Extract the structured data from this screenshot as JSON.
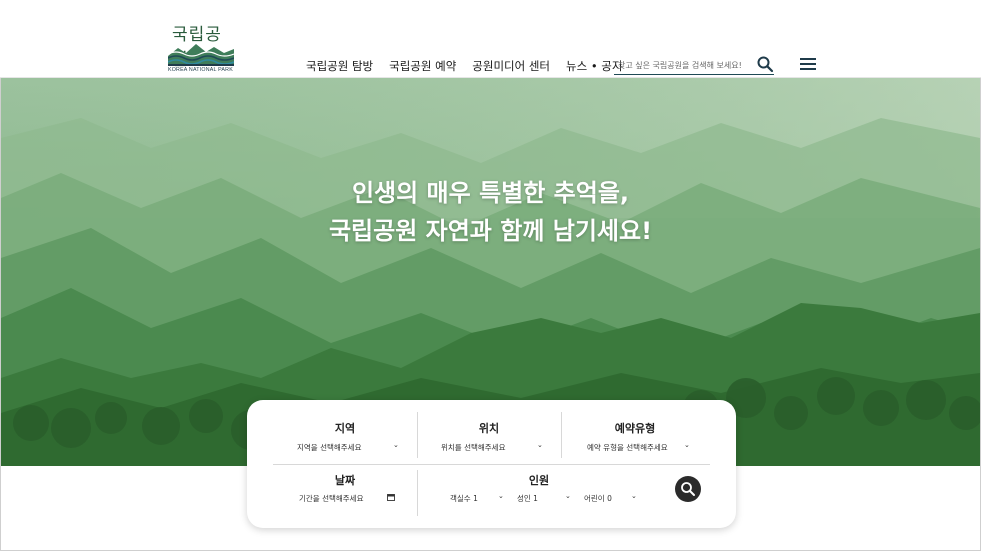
{
  "logo": {
    "korean": "국립공원",
    "english": "KOREA NATIONAL PARK"
  },
  "nav": {
    "items": [
      {
        "label": "국립공원 탐방"
      },
      {
        "label": "국립공원 예약"
      },
      {
        "label": "공원미디어 센터"
      },
      {
        "label": "뉴스 • 공지"
      }
    ]
  },
  "search": {
    "placeholder": "찾고 싶은 국립공원을 검색해 보세요!"
  },
  "hero": {
    "line1": "인생의 매우 특별한 추억을,",
    "line2": "국립공원 자연과 함께 남기세요!"
  },
  "booking": {
    "region": {
      "title": "지역",
      "value": "지역을 선택해주세요"
    },
    "location": {
      "title": "위치",
      "value": "위치를 선택해주세요"
    },
    "type": {
      "title": "예약유형",
      "value": "예약 유형을 선택해주세요"
    },
    "date": {
      "title": "날짜",
      "value": "기간을 선택해주세요"
    },
    "people": {
      "title": "인원",
      "rooms": "객실수 1",
      "adults": "성인 1",
      "children": "어린이 0"
    }
  },
  "colors": {
    "brand_green": "#2a5b3c",
    "nav_underline": "#1f4a56",
    "search_button": "#2b2b2b"
  }
}
